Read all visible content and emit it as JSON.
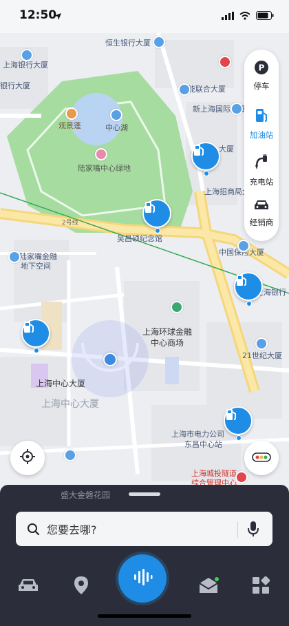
{
  "status_bar": {
    "time": "12:50"
  },
  "map": {
    "labels": {
      "hengsheng": "恒生银行大厦",
      "shanghai_bank": "上海银行大厦",
      "bank_tower": "银行大厦",
      "huaneng": "华能联合大厦",
      "new_intl": "新上海国际大厦",
      "guanjingtai": "观景蓬",
      "zhongxinhu": "中心湖",
      "ljz_greenland": "陆家嘴中心绿地",
      "line2": "2号线",
      "wuchangshuo": "吴昌硕纪念馆",
      "merchants": "上海招商局大",
      "tower_right": "大厦",
      "ljz_finance_a": "陆家嘴金融",
      "ljz_finance_b": "地下空间",
      "china_insurance": "中国保险大厦",
      "shanghai_bank_right": "上海银行",
      "swfc_mall_a": "上海环球金融",
      "swfc_mall_b": "中心商场",
      "century21": "21世纪大厦",
      "shanghai_tower_small": "上海中心大厦",
      "shanghai_tower_big": "上海中心大厦",
      "power_company": "上海市电力公司",
      "dongchang_station": "东昌中心站",
      "tunnel_a": "上海城投隧道",
      "tunnel_b": "综合管理中心",
      "shengda": "盛大金磐花园"
    }
  },
  "side_panel": {
    "items": [
      {
        "label": "停车",
        "icon": "parking-icon"
      },
      {
        "label": "加油站",
        "icon": "gas-station-icon",
        "active": true
      },
      {
        "label": "充电站",
        "icon": "charging-station-icon"
      },
      {
        "label": "经销商",
        "icon": "car-dealer-icon"
      }
    ]
  },
  "search": {
    "placeholder": "您要去哪?"
  },
  "tabbar": {
    "items": [
      "car-icon",
      "location-pin-icon",
      "voice-icon",
      "message-icon",
      "apps-icon"
    ]
  },
  "colors": {
    "accent": "#1f8de5",
    "dark": "#2b2e3a",
    "park": "#a6dca0"
  }
}
